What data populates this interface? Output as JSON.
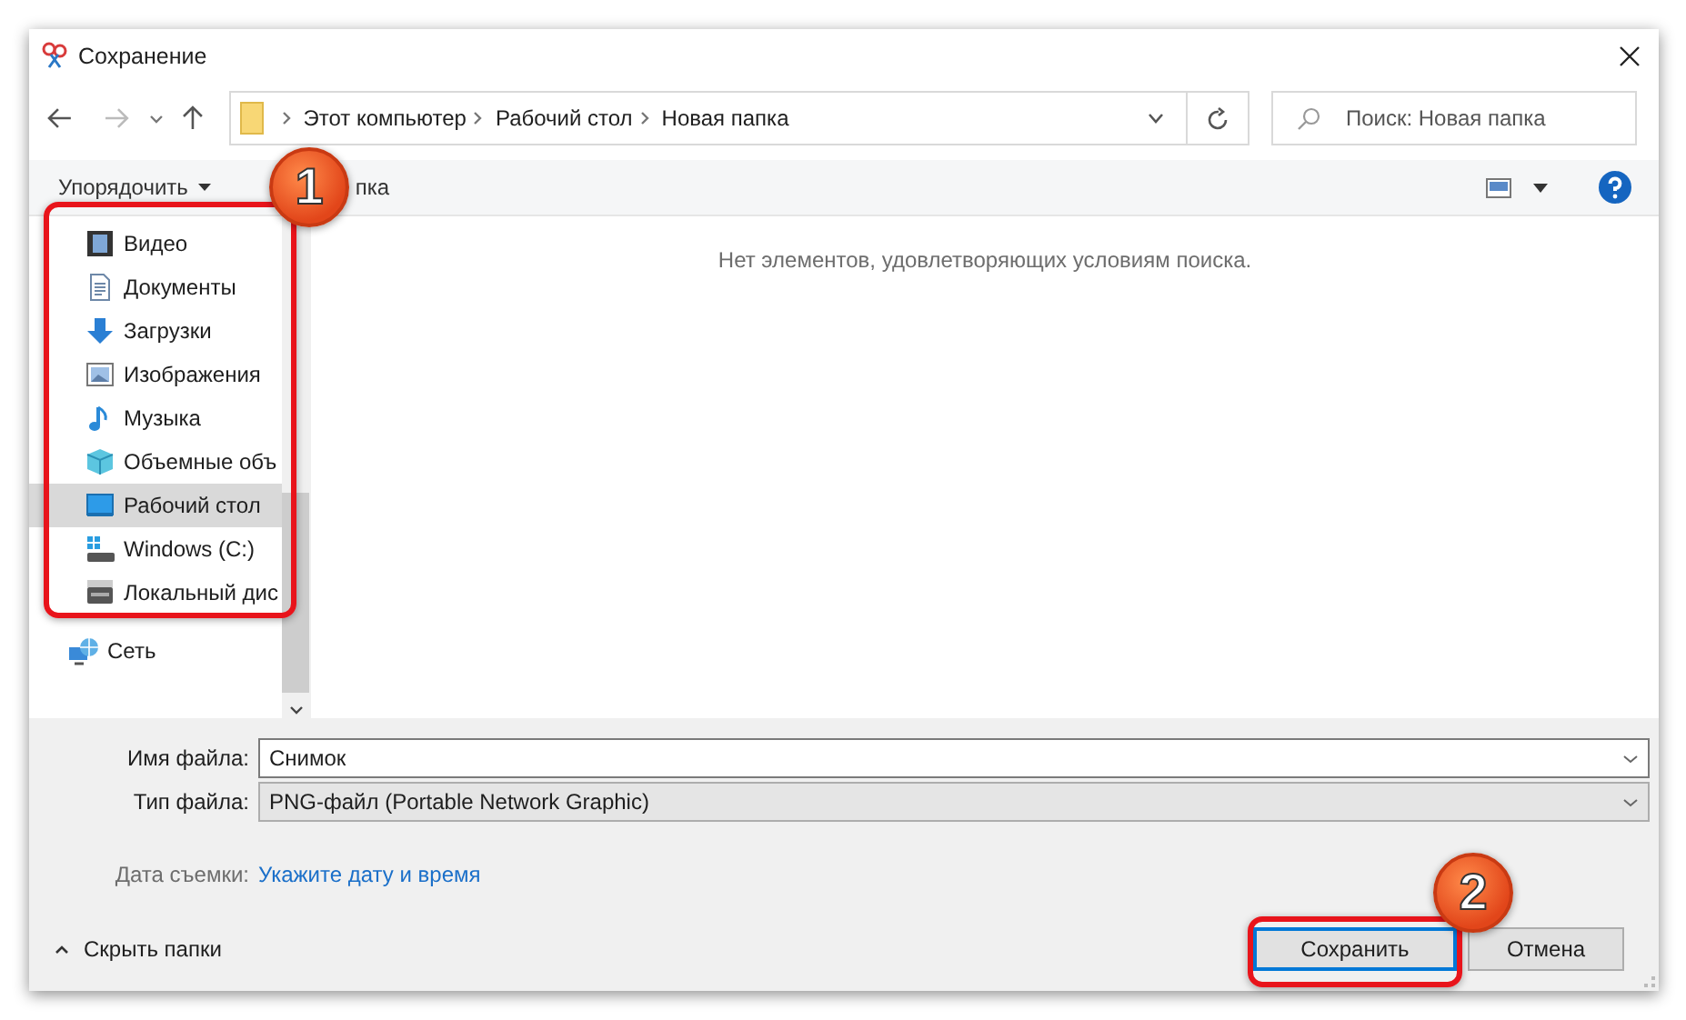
{
  "window": {
    "title": "Сохранение"
  },
  "navigation": {
    "breadcrumbs": [
      "Этот компьютер",
      "Рабочий стол",
      "Новая папка"
    ],
    "search": {
      "placeholder": "Поиск: Новая папка"
    }
  },
  "toolbar": {
    "organize": "Упорядочить",
    "new_folder": "пка"
  },
  "sidebar": {
    "items": [
      {
        "label": "Видео",
        "kind": "video",
        "selected": false
      },
      {
        "label": "Документы",
        "kind": "documents",
        "selected": false
      },
      {
        "label": "Загрузки",
        "kind": "downloads",
        "selected": false
      },
      {
        "label": "Изображения",
        "kind": "pictures",
        "selected": false
      },
      {
        "label": "Музыка",
        "kind": "music",
        "selected": false
      },
      {
        "label": "Объемные объ",
        "kind": "objects",
        "selected": false
      },
      {
        "label": "Рабочий стол",
        "kind": "desktop",
        "selected": true
      },
      {
        "label": "Windows (C:)",
        "kind": "system-drive",
        "selected": false
      },
      {
        "label": "Локальный дис",
        "kind": "drive",
        "selected": false
      }
    ],
    "root_items": [
      {
        "label": "Сеть",
        "kind": "network",
        "selected": false
      }
    ]
  },
  "content": {
    "empty_message": "Нет элементов, удовлетворяющих условиям поиска."
  },
  "form": {
    "file_name": {
      "label": "Имя файла:",
      "value": "Снимок"
    },
    "file_type": {
      "label": "Тип файла:",
      "value": "PNG-файл (Portable Network Graphic)"
    },
    "date": {
      "label": "Дата съемки:",
      "link": "Укажите дату и время"
    }
  },
  "hide_folders": "Скрыть папки",
  "buttons": [
    {
      "label": "Сохранить",
      "default": true
    },
    {
      "label": "Отмена",
      "default": false
    }
  ],
  "annotations": [
    {
      "number": "1"
    },
    {
      "number": "2"
    }
  ]
}
